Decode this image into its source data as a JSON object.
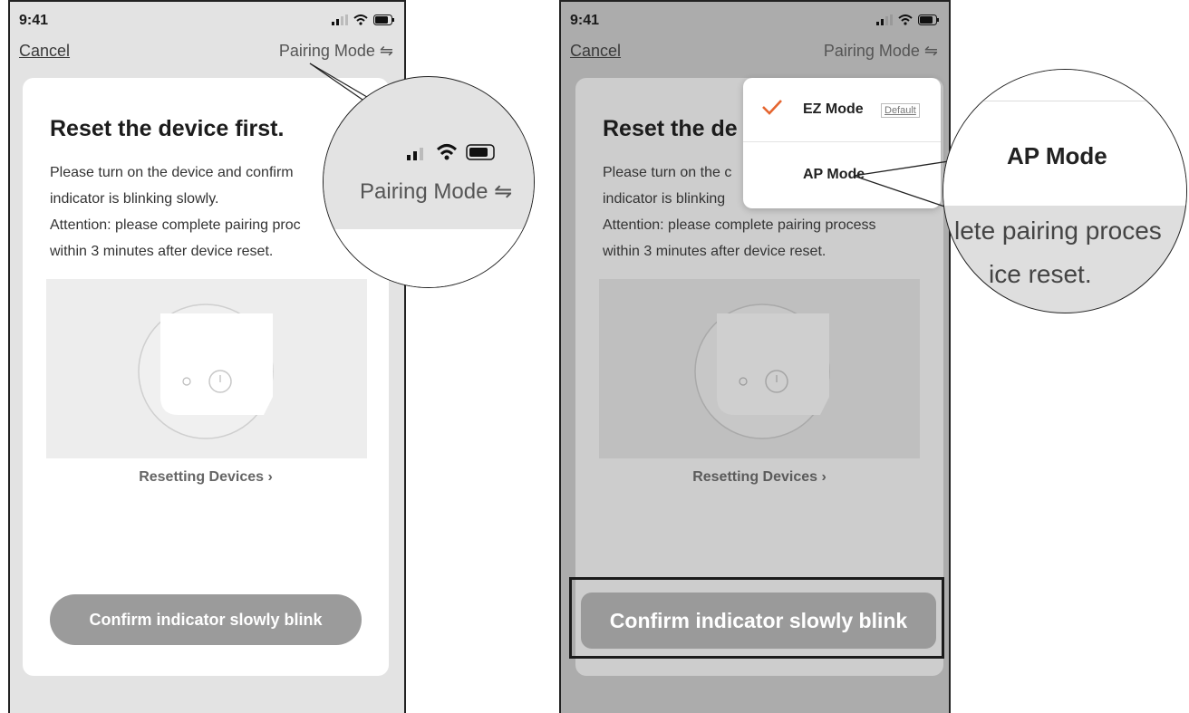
{
  "left_screen": {
    "status_time": "9:41",
    "nav": {
      "cancel": "Cancel",
      "pairing_mode": "Pairing Mode ⇋"
    },
    "card": {
      "title": "Reset the device first.",
      "lines": [
        "Please turn on the device and confirm",
        "indicator is blinking slowly.",
        "Attention: please complete pairing proc",
        "within 3 minutes after device reset."
      ],
      "reset_link": "Resetting Devices ›",
      "confirm_button": "Confirm indicator slowly blink"
    },
    "zoom": {
      "pairing_mode": "Pairing Mode ⇋"
    }
  },
  "right_screen": {
    "status_time": "9:41",
    "nav": {
      "cancel": "Cancel",
      "pairing_mode": "Pairing Mode ⇋"
    },
    "card": {
      "title": "Reset the de",
      "lines": [
        "Please turn on the c",
        "indicator is blinking",
        "Attention: please complete pairing process",
        "within 3 minutes after device reset."
      ],
      "reset_link": "Resetting Devices ›",
      "confirm_button": "Confirm indicator slowly blink"
    },
    "dropdown": {
      "items": [
        {
          "label": "EZ Mode",
          "badge": "Default",
          "selected": true
        },
        {
          "label": "AP Mode",
          "selected": false
        }
      ]
    },
    "zoom": {
      "title": "AP Mode",
      "line1": "lete pairing proces",
      "line2": "ice reset."
    }
  },
  "colors": {
    "check": "#e5652f",
    "card": "#ffffff",
    "button": "#9b9b9b"
  }
}
